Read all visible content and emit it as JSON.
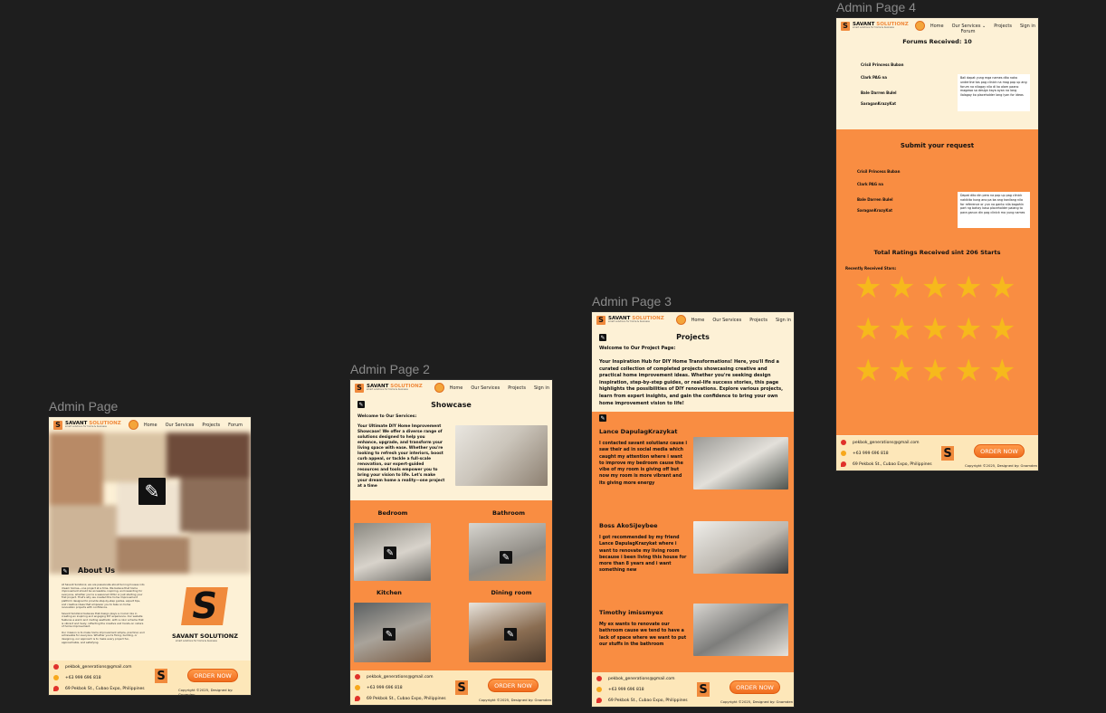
{
  "frames": {
    "p1": {
      "label": "Admin Page"
    },
    "p2": {
      "label": "Admin Page 2"
    },
    "p3": {
      "label": "Admin Page 3"
    },
    "p4": {
      "label": "Admin Page 4"
    }
  },
  "brand": {
    "name_dark": "SAVANT",
    "name_orange": "SOLUTIONZ",
    "tagline": "smart solutions for home & business",
    "mark": "S",
    "footer_brand": "SAVANT SOLUTIONZ",
    "footer_tagline": "smart solutions for home & business"
  },
  "nav1": [
    "Home",
    "Our Services",
    "Projects",
    "Forum"
  ],
  "nav2": [
    "Home",
    "Our Services",
    "Projects",
    "Sign in"
  ],
  "nav3": [
    "Home",
    "Our Services",
    "Projects",
    "Sign in"
  ],
  "nav4": {
    "home": "Home",
    "services": "Our Services ⌄",
    "projects": "Projects",
    "signin": "Sign in",
    "forum": "Forum"
  },
  "footer": {
    "email": "pekbok_generations@gmail.com",
    "phone": "+63 999 696 818",
    "address": "69 Pekbok St., Cubao Expo, Philippines",
    "order": "ORDER NOW",
    "copyright": "Copyright ©2025, Designed by: Gnomden"
  },
  "page1": {
    "about_title": "About Us",
    "about_p1": "At Savant Solutionz, we are passionate about turning houses into dream homes—one project at a time. We believe that home improvement should be accessible, inspiring, and rewarding for everyone, whether you're a seasoned DIYer or just starting your first project. That's why we created this home improvement platform designed to provide step-by-step guides, expert tips, and creative ideas that empower you to take on home renovation projects with confidence.",
    "about_p2": "Savant Solutionz believes that design plays a crucial role in creating an inspiring and engaging DIY experience. Our website features a warm and inviting aesthetic, with a color scheme that is vibrant and lively, reflecting the creative and hands-on nature of home improvement.",
    "about_p3": "Our mission is to make home improvement simple, practical, and achievable for everyone. Whether you're fixing, building, or designing, our approach is to make every project fun, approachable, and satisfying."
  },
  "page2": {
    "title": "Showcase",
    "welcome": "Welcome to Our Services:",
    "intro": "Your Ultimate DIY Home Improvement Showcase! We offer a diverse range of solutions designed to help you enhance, upgrade, and transform your living space with ease. Whether you're looking to refresh your interiors, boost curb appeal, or tackle a full-scale renovation, our expert-guided resources and tools empower you to bring your vision to life. Let's make your dream home a reality—one project at a time",
    "rooms": [
      "Bedroom",
      "Bathroom",
      "Kitchen",
      "Dining room"
    ]
  },
  "page3": {
    "title": "Projects",
    "welcome": "Welcome to Our Project Page:",
    "intro": "Your Inspiration Hub for DIY Home Transformations! Here, you'll find a curated collection of completed projects showcasing creative and practical home improvement ideas. Whether you're seeking design inspiration, step-by-step guides, or real-life success stories, this page highlights the possibilities of DIY renovations. Explore various projects, learn from expert insights, and gain the confidence to bring your own home improvement vision to life!",
    "reviews": [
      {
        "name": "Lance DapulagKrazykat",
        "text": "I contacted savant solutianz cause i saw their ad in social media which caught my attention where i want to improve my bedroom cause the vibe of my room is giving off but now my room is more vibrant and its giving more energy"
      },
      {
        "name": "Boss AkoSiJeybee",
        "text": "I got recommended by my friend Lance DapulagKrazykat where i want to renovate my living room because i been living this house for more than 8 years and i want something new"
      },
      {
        "name": "Timothy imissmyex",
        "text": "My ex wants to renovate our bathroom cause we tend to have a lack of space where we want to put our stuffs in the bathroom"
      }
    ]
  },
  "page4": {
    "forums_title": "Forums Received: 10",
    "forum_users": [
      "Crisil Princess Buban",
      "Clark PAG na",
      "Bale Darren Bulel",
      "SaraganKrazyKat"
    ],
    "forum_message": "Bali dapat yung mga names dito naka underline tas pag clinick na mag pop up ang forum na nilagay nila di ko alam paano magawa sa design kaya ayan na lang ilalagay ko placeholder lang iyan for ideas",
    "submit_title": "Submit your request",
    "request_users": [
      "Crisil Princess Buban",
      "Clark PAG na",
      "Bale Darren Bulel",
      "SaraganKrazyKat"
    ],
    "request_message": "Dapat dito din pero na pop up pag clinick nakikita kung ano pa ba ang kanilang nila for reference or yun na ganto nila bagahin part ng bahay kaso placeholder palang to para ganun din pag clinick mo yung names",
    "ratings_title": "Total Ratings Received sint 206 Starts",
    "recent_label": "Recently Received Stars:",
    "star_rows": [
      5,
      5,
      5
    ]
  },
  "colors": {
    "cream": "#fdf1d6",
    "orange": "#f98d42",
    "star": "#f6b91c",
    "canvas": "#1e1e1e"
  }
}
